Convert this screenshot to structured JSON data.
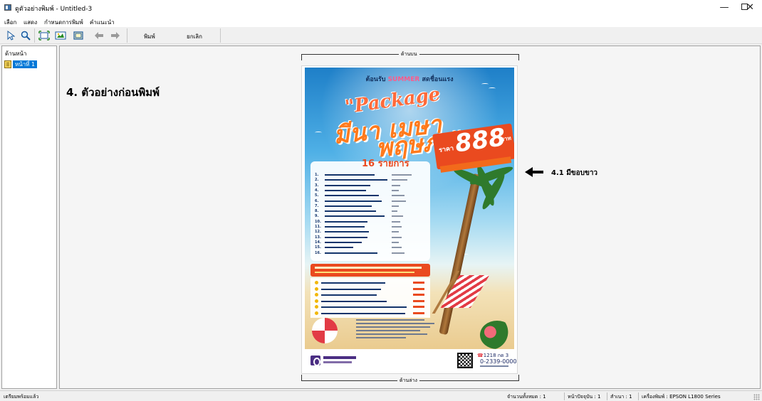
{
  "window": {
    "title": "ดูตัวอย่างพิมพ์ - Untitled-3",
    "controls": {
      "minimize_label": "—",
      "maximize_label": "",
      "close_label": "✕"
    }
  },
  "menu": {
    "items": [
      "เลือก",
      "แสดง",
      "กำหนดการพิมพ์",
      "คำแนะนำ"
    ]
  },
  "toolbar": {
    "icons": [
      "pointer-icon",
      "zoom-icon",
      "fit-page-icon",
      "fit-image-icon",
      "page-frame-icon",
      "back-arrow-icon",
      "forward-arrow-icon"
    ],
    "print_label": "พิมพ์",
    "cancel_label": "ยกเลิก"
  },
  "sidebar": {
    "header": "ด้านหน้า",
    "items": [
      {
        "label": "หน้าที่ 1",
        "selected": true
      }
    ]
  },
  "main": {
    "note_title": "4. ตัวอย่างก่อนพิมพ์",
    "top_margin_label": "ด้านบน",
    "bottom_margin_label": "ด้านล่าง",
    "annotation_text": "4.1 มีขอบขาว"
  },
  "poster": {
    "headline_prefix": "ต้อนรับ",
    "headline_summer": "SUMMER",
    "headline_suffix": "สดชื่อนแรง",
    "package_text": "\"Package",
    "month_line1": "มีนา เมษา",
    "month_line2": "พฤษภา\"",
    "price_prefix": "ราคา",
    "price_value": "888",
    "price_unit": "บาท",
    "list_title": "16 รายการ",
    "list_numbers": [
      "1.",
      "2.",
      "3.",
      "4.",
      "5.",
      "6.",
      "7.",
      "8.",
      "9.",
      "10.",
      "11.",
      "12.",
      "13.",
      "14.",
      "15.",
      "16."
    ],
    "contact_line1": "1218 กด 3",
    "contact_line2": "0-2339-0000"
  },
  "status": {
    "ready": "เตรียมพร้อมแล้ว",
    "total_pages": "จำนวนทั้งหมด : 1",
    "current_page": "หน้าปัจจุบัน : 1",
    "copies": "สำเนา : 1",
    "printer": "เครื่องพิมพ์ : EPSON L1800 Series"
  }
}
